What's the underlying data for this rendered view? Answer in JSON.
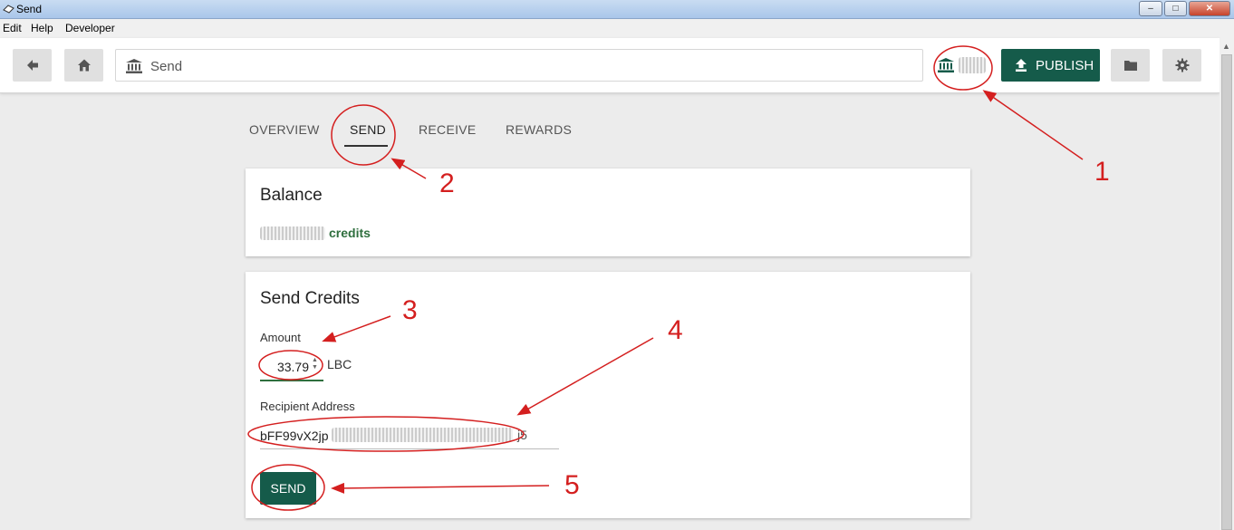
{
  "window": {
    "title": "Send",
    "minimize": "–",
    "maximize": "□",
    "close": "✕"
  },
  "menu": [
    "Edit",
    "Help",
    "Developer"
  ],
  "header": {
    "back_icon": "arrow-left-icon",
    "home_icon": "home-icon",
    "search_value": "Send",
    "publish_label": "PUBLISH",
    "folder_icon": "folder-icon",
    "settings_icon": "gear-icon"
  },
  "tabs": [
    {
      "label": "OVERVIEW",
      "active": false
    },
    {
      "label": "SEND",
      "active": true
    },
    {
      "label": "RECEIVE",
      "active": false
    },
    {
      "label": "REWARDS",
      "active": false
    }
  ],
  "balance": {
    "title": "Balance",
    "unit": "credits"
  },
  "send_credits": {
    "title": "Send Credits",
    "amount_label": "Amount",
    "amount_value": "33.79",
    "amount_unit": "LBC",
    "recipient_label": "Recipient Address",
    "recipient_value": "bFF99vX2jp",
    "recipient_tail": "j5",
    "send_label": "SEND"
  },
  "annotations": [
    "1",
    "2",
    "3",
    "4",
    "5"
  ],
  "colors": {
    "brand_green": "#155b4a",
    "annotation_red": "#d41f1f",
    "credits_green": "#2f6f3e"
  }
}
